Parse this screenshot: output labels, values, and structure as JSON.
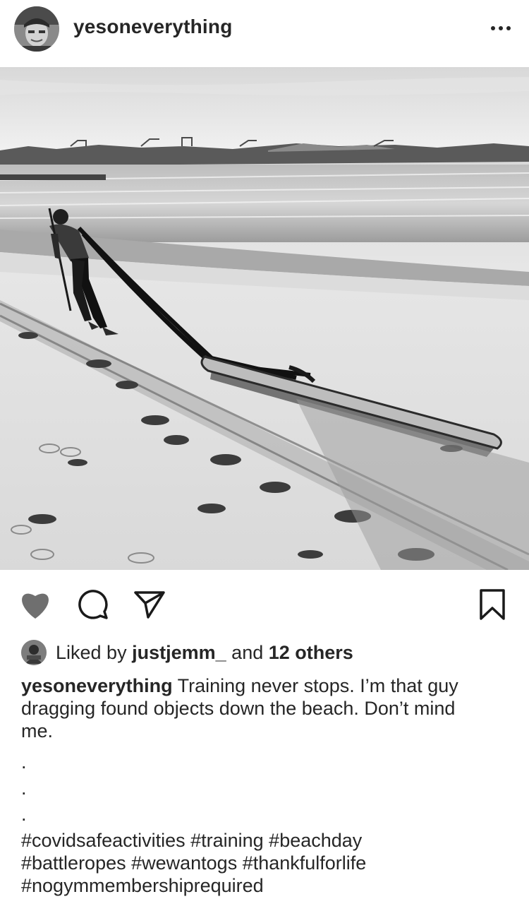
{
  "post": {
    "username": "yesoneverything",
    "more_icon": "more-horizontal-icon"
  },
  "photo": {
    "description": "black-and-white beach photo",
    "icon": "photo"
  },
  "actions": {
    "like_icon": "heart-icon",
    "comment_icon": "comment-icon",
    "share_icon": "send-icon",
    "save_icon": "bookmark-icon"
  },
  "likes": {
    "prefix": "Liked by",
    "user": "justjemm_",
    "middle": "and",
    "others": "12 others"
  },
  "caption": {
    "username": "yesoneverything",
    "line1": "Training never stops. I’m that guy",
    "line2": "dragging found objects down the beach. Don’t mind",
    "line3": "me.",
    "dots": [
      ".",
      ".",
      "."
    ],
    "hashtags": [
      "#covidsafeactivities #training #beachday",
      "#battleropes #wewantogs #thankfulforlife",
      "#nogymmembershiprequired"
    ]
  },
  "colors": {
    "text": "#262626",
    "background": "#ffffff",
    "icon": "#1a1a1a",
    "heart": "#6f6f6f"
  }
}
